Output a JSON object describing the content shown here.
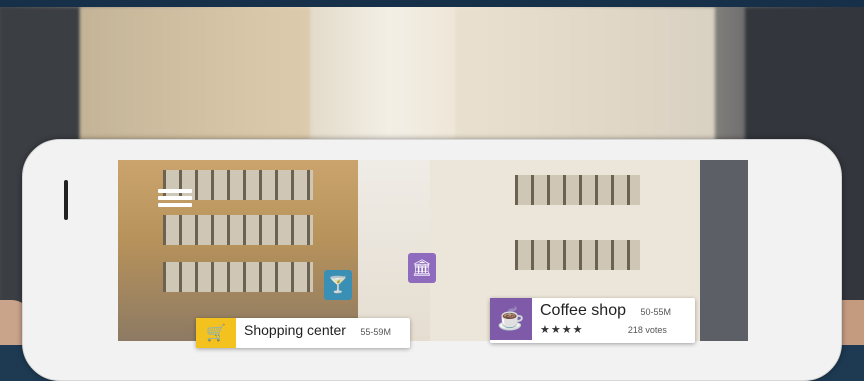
{
  "scene": {
    "accent_colors": {
      "coffee": "#7f5aa8",
      "shopping": "#f3c21f",
      "bar": "#3a8fb5",
      "museum": "#8e6bbd"
    }
  },
  "ar_labels": {
    "coffee": {
      "name": "Coffee shop",
      "distance": "50-55M",
      "rating": "★★★★",
      "votes": "218 votes",
      "icon": "coffee-cup-icon"
    },
    "shopping": {
      "name": "Shopping center",
      "distance": "55-59M",
      "icon": "shopping-cart-icon"
    }
  },
  "markers": [
    {
      "icon": "cocktail-icon",
      "glyph": "🍸"
    },
    {
      "icon": "museum-icon",
      "glyph": "🏛"
    }
  ]
}
